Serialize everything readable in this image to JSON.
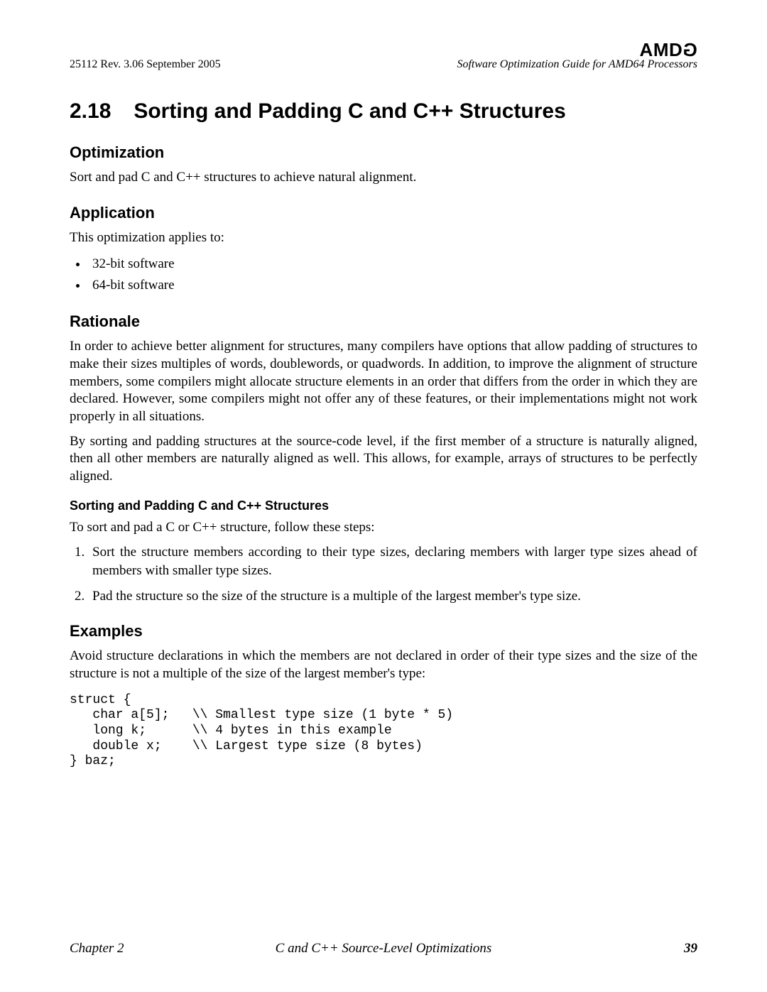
{
  "header": {
    "logo_text": "AMD",
    "logo_glyph": "G",
    "doc_left": "25112   Rev. 3.06   September 2005",
    "doc_right": "Software Optimization Guide for AMD64 Processors"
  },
  "section": {
    "number": "2.18",
    "title": "Sorting and Padding C and C++ Structures"
  },
  "optimization": {
    "heading": "Optimization",
    "text": "Sort and pad C and C++ structures to achieve natural alignment."
  },
  "application": {
    "heading": "Application",
    "intro": "This optimization applies to:",
    "items": [
      "32-bit software",
      "64-bit software"
    ]
  },
  "rationale": {
    "heading": "Rationale",
    "p1": "In order to achieve better alignment for structures, many compilers have options that allow padding of structures to make their sizes multiples of words, doublewords, or quadwords. In addition, to improve the alignment of structure members, some compilers might allocate structure elements in an order that differs from the order in which they are declared. However, some compilers might not offer any of these features, or their implementations might not work properly in all situations.",
    "p2": "By sorting and padding structures at the source-code level, if the first member of a structure is naturally aligned, then all other members are naturally aligned as well. This allows, for example, arrays of structures to be perfectly aligned."
  },
  "howto": {
    "heading": "Sorting and Padding C and C++ Structures",
    "intro": "To sort and pad a C or C++ structure, follow these steps:",
    "steps": [
      "Sort the structure members according to their type sizes, declaring members with larger type sizes ahead of members with smaller type sizes.",
      "Pad the structure so the size of the structure is a multiple of the largest member's type size."
    ]
  },
  "examples": {
    "heading": "Examples",
    "intro": "Avoid structure declarations in which the members are not declared in order of their type sizes and the size of the structure is not a multiple of the size of the largest member's type:",
    "code": "struct {\n   char a[5];   \\\\ Smallest type size (1 byte * 5)\n   long k;      \\\\ 4 bytes in this example\n   double x;    \\\\ Largest type size (8 bytes)\n} baz;"
  },
  "footer": {
    "left": "Chapter 2",
    "center": "C and C++ Source-Level Optimizations",
    "page": "39"
  }
}
